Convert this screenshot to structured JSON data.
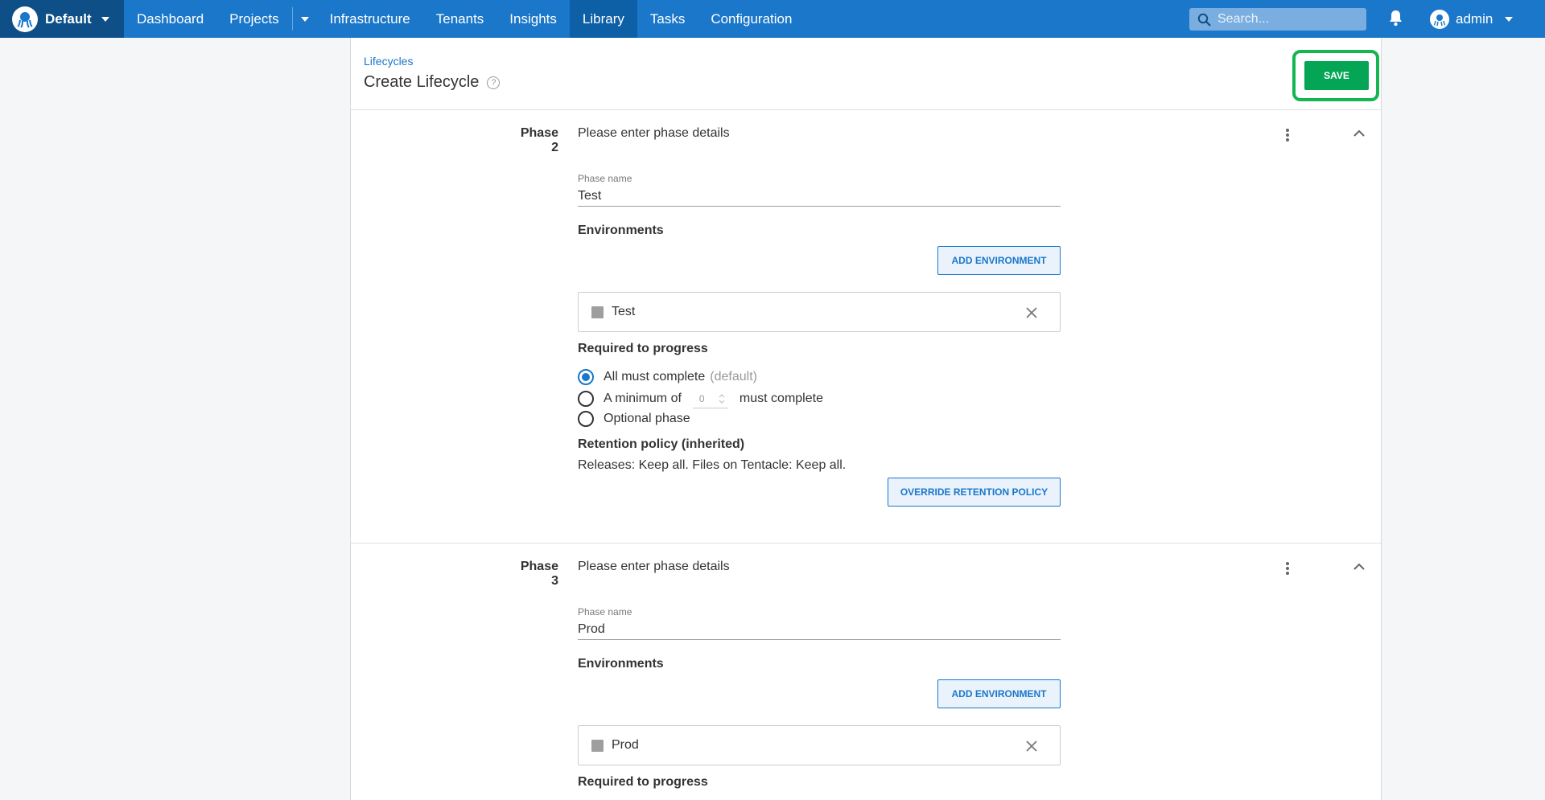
{
  "nav": {
    "space": "Default",
    "items": [
      "Dashboard",
      "Projects",
      "Infrastructure",
      "Tenants",
      "Insights",
      "Library",
      "Tasks",
      "Configuration"
    ],
    "active": "Library",
    "search_placeholder": "Search...",
    "user": "admin"
  },
  "header": {
    "breadcrumb": "Lifecycles",
    "title": "Create Lifecycle",
    "save_label": "SAVE"
  },
  "phases": [
    {
      "label": "Phase 2",
      "summary": "Please enter phase details",
      "name_label": "Phase name",
      "name": "Test",
      "environments_heading": "Environments",
      "add_env_label": "ADD ENVIRONMENT",
      "environment": "Test",
      "required_heading": "Required to progress",
      "options": {
        "all": "All must complete",
        "all_note": "(default)",
        "min_prefix": "A minimum of",
        "min_value": "0",
        "min_suffix": "must complete",
        "optional": "Optional phase"
      },
      "selected_option": "all",
      "retention_heading": "Retention policy (inherited)",
      "retention_text": "Releases: Keep all. Files on Tentacle: Keep all.",
      "override_label": "OVERRIDE RETENTION POLICY"
    },
    {
      "label": "Phase 3",
      "summary": "Please enter phase details",
      "name_label": "Phase name",
      "name": "Prod",
      "environments_heading": "Environments",
      "add_env_label": "ADD ENVIRONMENT",
      "environment": "Prod",
      "required_heading": "Required to progress"
    }
  ],
  "colors": {
    "nav": "#1a77ca",
    "nav_dark": "#0d4f86",
    "save": "#04a656",
    "highlight": "#15b551"
  }
}
